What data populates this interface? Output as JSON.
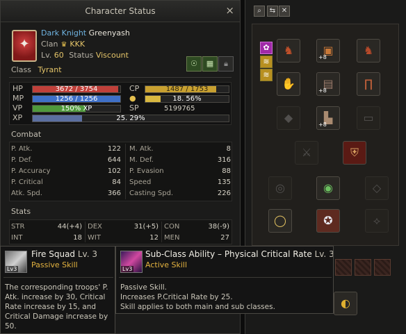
{
  "window": {
    "title": "Character Status",
    "close_icon": "×"
  },
  "character": {
    "class_name": "Dark Knight",
    "name": "Greenyash",
    "clan_label": "Clan",
    "clan_name": "KKK",
    "level_label": "Lv.",
    "level": "60",
    "status_label": "Status",
    "status_value": "Viscount",
    "class_label": "Class",
    "class_value": "Tyrant"
  },
  "bars": {
    "hp": {
      "label": "HP",
      "text": "3672 / 3754",
      "fraction": 0.978,
      "color": "#c0403a"
    },
    "mp": {
      "label": "MP",
      "text": "1256 / 1256",
      "fraction": 1.0,
      "color": "#3f70c8"
    },
    "vp": {
      "label": "VP",
      "text": "150% XP",
      "fraction": 0.6,
      "color": "#4f9a3c"
    },
    "cp": {
      "label": "CP",
      "text": "1487 / 1753",
      "fraction": 0.848,
      "color": "#c8a030"
    },
    "pct": {
      "text": "18. 56%",
      "fraction": 0.1856,
      "color": "#d8b840"
    },
    "sp": {
      "label": "SP",
      "text": "5199765"
    },
    "xp": {
      "label": "XP",
      "text": "25. 29%",
      "fraction": 0.2529,
      "color": "#5b6fa0"
    }
  },
  "combat": {
    "heading": "Combat",
    "left": [
      {
        "label": "P. Atk.",
        "value": "122"
      },
      {
        "label": "P. Def.",
        "value": "644"
      },
      {
        "label": "P. Accuracy",
        "value": "102"
      },
      {
        "label": "P. Critical",
        "value": "84"
      },
      {
        "label": "Atk. Spd.",
        "value": "366"
      }
    ],
    "right": [
      {
        "label": "M. Atk.",
        "value": "8"
      },
      {
        "label": "M. Def.",
        "value": "316"
      },
      {
        "label": "P. Evasion",
        "value": "88"
      },
      {
        "label": "Speed",
        "value": "135"
      },
      {
        "label": "Casting Spd.",
        "value": "226"
      }
    ]
  },
  "stats": {
    "heading": "Stats",
    "rows": [
      [
        {
          "label": "STR",
          "value": "44(+4)"
        },
        {
          "label": "DEX",
          "value": "31(+5)"
        },
        {
          "label": "CON",
          "value": "38(-9)"
        }
      ],
      [
        {
          "label": "INT",
          "value": "18"
        },
        {
          "label": "WIT",
          "value": "12"
        },
        {
          "label": "MEN",
          "value": "27"
        }
      ]
    ]
  },
  "tooltip_left": {
    "name": "Fire Squad",
    "level": "Lv. 3",
    "type": "Passive Skill",
    "icon_level": "Lv3",
    "description": "The corresponding troops' P. Atk. increase by 30, Critical Rate increase by 15, and Critical Damage increase by 50."
  },
  "tooltip_right": {
    "name": "Sub-Class Ability – Physical Critical Rate",
    "level": "Lv. 3",
    "type": "Active Skill",
    "icon_level": "Lv3",
    "line1": "Passive Skill.",
    "line2": "Increases P.Critical Rate by 25.",
    "line3": "Skill applies to both main and sub classes."
  },
  "equipment": {
    "enchant_plus": "+8"
  }
}
